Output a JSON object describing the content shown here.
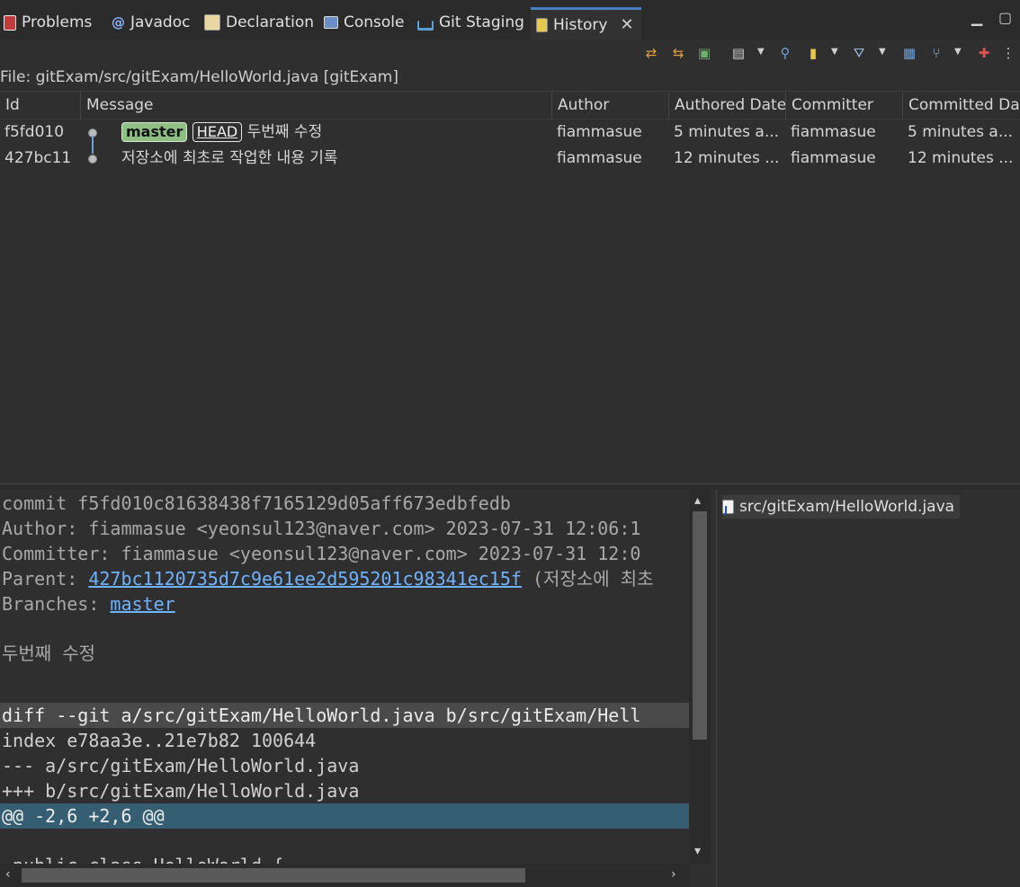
{
  "tabs": [
    {
      "label": "Problems",
      "icon": "problems-icon"
    },
    {
      "label": "Javadoc",
      "icon": "javadoc-icon",
      "glyph": "@"
    },
    {
      "label": "Declaration",
      "icon": "declaration-icon"
    },
    {
      "label": "Console",
      "icon": "console-icon"
    },
    {
      "label": "Git Staging",
      "icon": "git-staging-icon"
    },
    {
      "label": "History",
      "icon": "history-icon",
      "active": true
    }
  ],
  "path_label": "File: gitExam/src/gitExam/HelloWorld.java [gitExam]",
  "table": {
    "columns": [
      "Id",
      "Message",
      "Author",
      "Authored Date",
      "Committer",
      "Committed Da"
    ],
    "rows": [
      {
        "id": "f5fd010",
        "branch": "master",
        "head": "HEAD",
        "message": "두번째 수정",
        "author": "fiammasue",
        "authored": "5 minutes a...",
        "committer": "fiammasue",
        "committed": "5 minutes a..."
      },
      {
        "id": "427bc11",
        "message": "저장소에 최초로 작업한 내용 기록",
        "author": "fiammasue",
        "authored": "12 minutes ...",
        "committer": "fiammasue",
        "committed": "12 minutes ..."
      }
    ]
  },
  "commit": {
    "line1": "commit f5fd010c81638438f7165129d05aff673edbfedb",
    "line2": "Author: fiammasue <yeonsul123@naver.com> 2023-07-31 12:06:1",
    "line3": "Committer: fiammasue <yeonsul123@naver.com> 2023-07-31 12:0",
    "parent_label": "Parent: ",
    "parent_hash": "427bc1120735d7c9e61ee2d595201c98341ec15f",
    "parent_msg": " (저장소에 최초",
    "branches_label": "Branches: ",
    "branches_value": "master",
    "message": "두번째 수정",
    "diff_header": "diff --git a/src/gitExam/HelloWorld.java b/src/gitExam/Hell",
    "index_line": "index e78aa3e..21e7b82 100644",
    "minus_line": "--- a/src/gitExam/HelloWorld.java",
    "plus_line": "+++ b/src/gitExam/HelloWorld.java",
    "hunk": "@@ -2,6 +2,6 @@",
    "code_partial": " public class HelloWorld {"
  },
  "files": [
    {
      "name": "src/gitExam/HelloWorld.java",
      "icon": "java-file-icon"
    }
  ],
  "colors": {
    "link": "#6fb3ff",
    "hunk_bg": "#365e73",
    "branch_badge": "#8fbf85",
    "active_tab_border": "#4a7fbf"
  }
}
